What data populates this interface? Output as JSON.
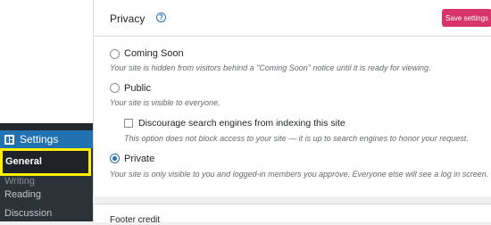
{
  "sidebar": {
    "section_label": "Settings",
    "items": [
      {
        "label": "General"
      },
      {
        "label": "Writing"
      },
      {
        "label": "Reading"
      },
      {
        "label": "Discussion"
      }
    ]
  },
  "privacy": {
    "title": "Privacy",
    "help_icon": "?",
    "save_label": "Save settings",
    "options": [
      {
        "label": "Coming Soon",
        "description": "Your site is hidden from visitors behind a \"Coming Soon\" notice until it is ready for viewing.",
        "checked": false
      },
      {
        "label": "Public",
        "description": "Your site is visible to everyone.",
        "checked": false
      },
      {
        "label": "Private",
        "description": "Your site is only visible to you and logged-in members you approve. Everyone else will see a log in screen.",
        "checked": true
      }
    ],
    "discourage": {
      "label": "Discourage search engines from indexing this site",
      "description": "This option does not block access to your site — it is up to search engines to honor your request.",
      "checked": false
    }
  },
  "footer": {
    "title": "Footer credit"
  },
  "colors": {
    "accent": "#2271b1",
    "save_button": "#d8336b",
    "highlight": "#ffef00",
    "sidebar_bg": "#23282d"
  }
}
